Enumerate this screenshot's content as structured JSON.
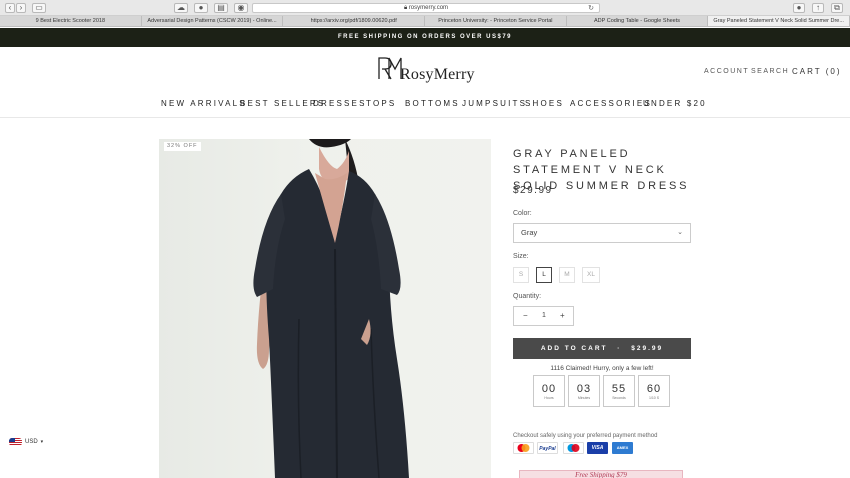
{
  "browser": {
    "url": "rosymerry.com",
    "tabs": [
      {
        "label": "9 Best Electric Scooter 2018",
        "active": false
      },
      {
        "label": "Adversarial Design Patterns (CSCW 2019) - Online...",
        "active": false
      },
      {
        "label": "https://arxiv.org/pdf/1809.00620.pdf",
        "active": false
      },
      {
        "label": "Princeton University: - Princeton Service Portal",
        "active": false
      },
      {
        "label": "ADP Coding Table - Google Sheets",
        "active": false
      },
      {
        "label": "Gray Paneled Statement V Neck Solid Summer Dre...",
        "active": true
      }
    ]
  },
  "announcement": "FREE SHIPPING ON ORDERS OVER US$79",
  "header": {
    "logo_text": "RosyMerry",
    "account": "ACCOUNT",
    "search": "SEARCH",
    "cart": "CART (0)"
  },
  "nav": [
    "NEW ARRIVALS",
    "BEST SELLERS",
    "DRESSES",
    "TOPS",
    "BOTTOMS",
    "JUMPSUITS",
    "SHOES",
    "ACCESSORIES",
    "UNDER $20"
  ],
  "product": {
    "badge": "32% OFF",
    "title": "GRAY PANELED STATEMENT V NECK SOLID SUMMER DRESS",
    "price": "$29.99",
    "color_label": "Color:",
    "color_value": "Gray",
    "size_label": "Size:",
    "sizes": [
      "S",
      "L",
      "M",
      "XL"
    ],
    "selected_size": "L",
    "quantity_label": "Quantity:",
    "quantity": "1",
    "add_to_cart": "ADD TO CART",
    "add_to_cart_price": "$29.99",
    "claimed": "1116  Claimed! Hurry, only a few left!",
    "countdown": [
      {
        "value": "00",
        "unit": "Hours"
      },
      {
        "value": "03",
        "unit": "Minutes"
      },
      {
        "value": "55",
        "unit": "Seconds"
      },
      {
        "value": "60",
        "unit": "1/10 S"
      }
    ],
    "checkout_text": "Checkout safely using your preferred payment method",
    "payment_methods": [
      "MasterCard",
      "PayPal",
      "Maestro",
      "VISA",
      "AMEX"
    ],
    "promo_text": "Free Shipping $79"
  },
  "currency": "USD"
}
